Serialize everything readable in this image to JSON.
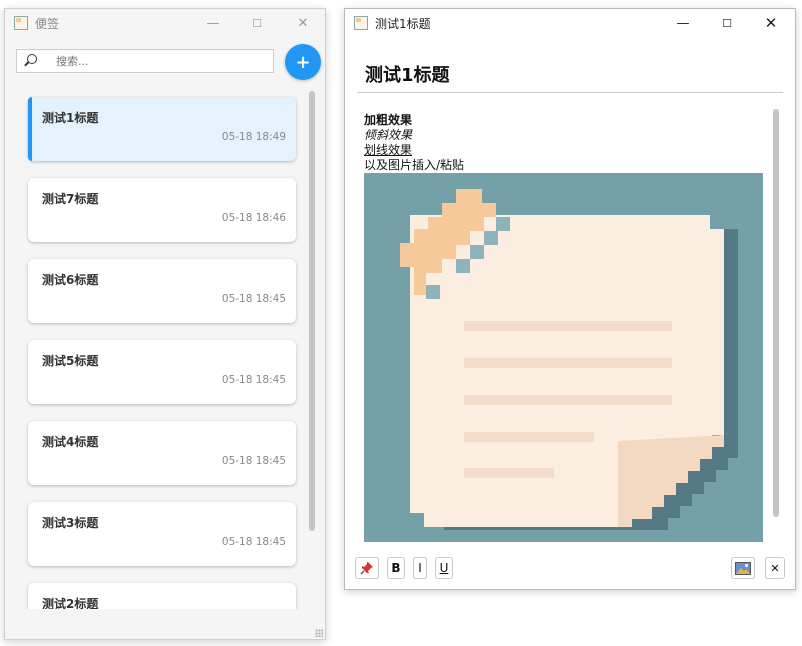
{
  "list_window": {
    "title": "便签",
    "search": {
      "placeholder": "搜索...",
      "value": ""
    },
    "add_label": "+",
    "notes": [
      {
        "title": "测试1标题",
        "time": "05-18 18:49",
        "active": true
      },
      {
        "title": "测试7标题",
        "time": "05-18 18:46",
        "active": false
      },
      {
        "title": "测试6标题",
        "time": "05-18 18:45",
        "active": false
      },
      {
        "title": "测试5标题",
        "time": "05-18 18:45",
        "active": false
      },
      {
        "title": "测试4标题",
        "time": "05-18 18:45",
        "active": false
      },
      {
        "title": "测试3标题",
        "time": "05-18 18:45",
        "active": false
      },
      {
        "title": "测试2标题",
        "time": "",
        "active": false
      }
    ]
  },
  "editor_window": {
    "title": "测试1标题",
    "note_title": "测试1标题",
    "content": {
      "bold_line": "加粗效果",
      "italic_line": "倾斜效果",
      "underline_line": "划线效果",
      "plain_line": "以及图片插入/粘贴"
    },
    "toolbar": {
      "pin_icon": "pin-icon",
      "bold_label": "B",
      "italic_label": "I",
      "underline_label": "U",
      "image_icon": "image-icon",
      "close_label": "✕"
    }
  },
  "window_controls": {
    "minimize": "—",
    "maximize": "☐",
    "close": "✕"
  },
  "colors": {
    "accent": "#2196f3",
    "active_card": "#e3f2fd"
  }
}
